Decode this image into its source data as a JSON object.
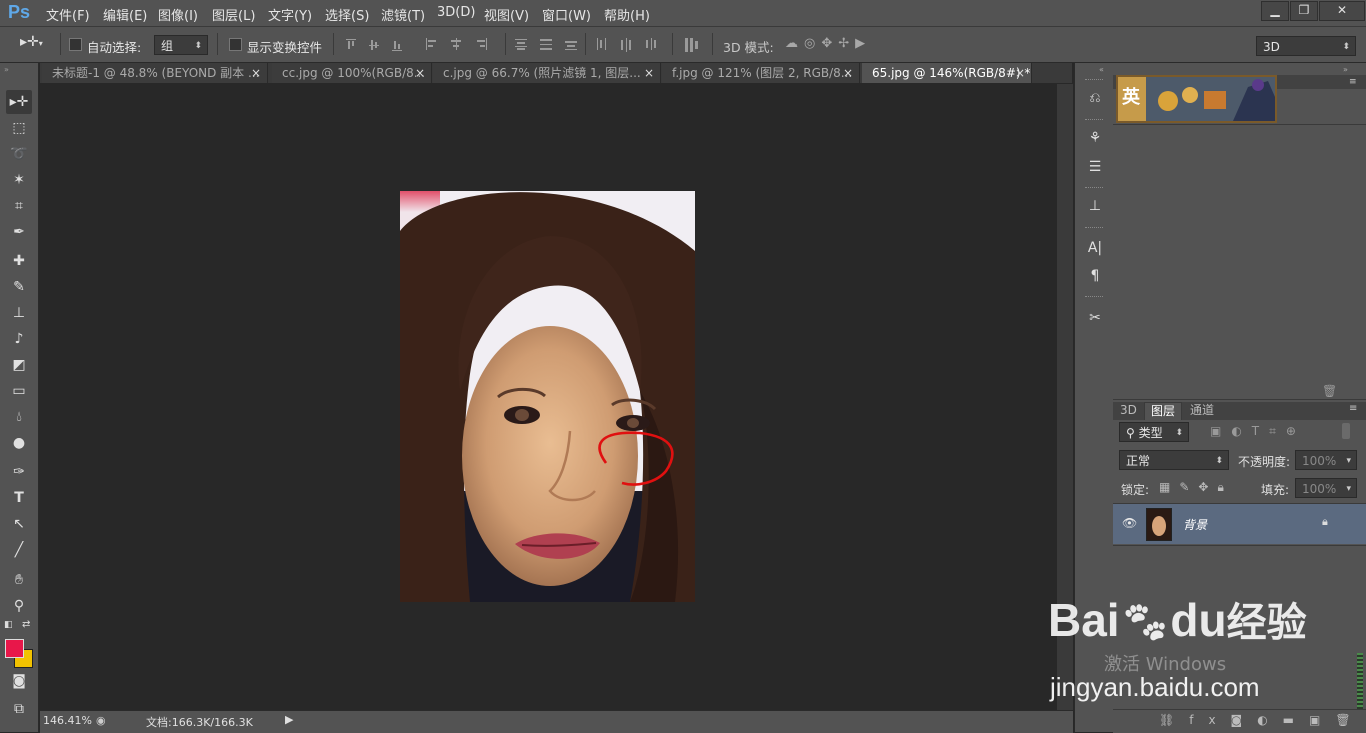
{
  "app": {
    "logo": "Ps"
  },
  "menu": [
    "文件(F)",
    "编辑(E)",
    "图像(I)",
    "图层(L)",
    "文字(Y)",
    "选择(S)",
    "滤镜(T)",
    "3D(D)",
    "视图(V)",
    "窗口(W)",
    "帮助(H)"
  ],
  "window_controls": {
    "minimize": "▁",
    "restore": "❐",
    "close": "✕"
  },
  "options": {
    "auto_select_label": "自动选择:",
    "auto_select_value": "组",
    "show_transform_label": "显示变换控件",
    "mode3d_label": "3D 模式:",
    "workspace_value": "3D"
  },
  "tabs": [
    {
      "label": "未标题-1 @ 48.8% (BEYOND 副本 ...",
      "close": "×"
    },
    {
      "label": "cc.jpg @ 100%(RGB/8...",
      "close": "×"
    },
    {
      "label": "c.jpg @ 66.7% (照片滤镜 1, 图层...",
      "close": "×"
    },
    {
      "label": "f.jpg @ 121% (图层 2, RGB/8...",
      "close": "×"
    },
    {
      "label": "65.jpg @ 146%(RGB/8#) *",
      "close": "×"
    }
  ],
  "status": {
    "zoom": "146.41%",
    "doc_info": "文档:166.3K/166.3K"
  },
  "layers_panel": {
    "tabs": [
      "3D",
      "图层",
      "通道"
    ],
    "active_tab": "图层",
    "filter_kind": "类型",
    "blend_mode": "正常",
    "opacity_label": "不透明度:",
    "opacity_value": "100%",
    "lock_label": "锁定:",
    "fill_label": "填充:",
    "fill_value": "100%",
    "layers": [
      {
        "name": "背景"
      }
    ]
  },
  "swatch_panel": {
    "thumb_text": "英"
  },
  "watermark": {
    "brand": "Bai",
    "brand_du": "du",
    "brand_cn": "经验",
    "url": "jingyan.baidu.com",
    "activate": "激活 Windows"
  },
  "colors": {
    "foreground": "#e8174a",
    "background": "#f2c200",
    "annotation": "#e01010"
  }
}
